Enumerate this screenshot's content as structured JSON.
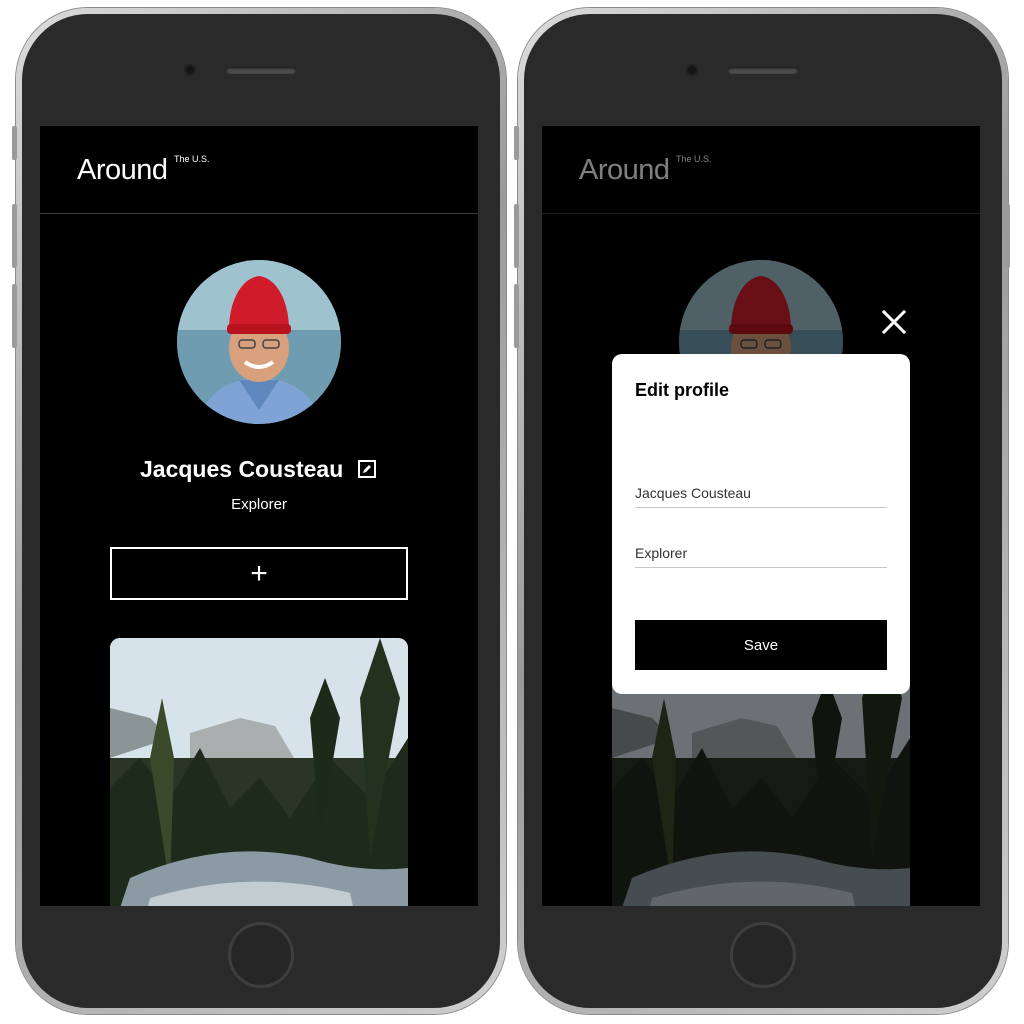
{
  "header": {
    "logo": "Around",
    "logo_superscript": "The U.S."
  },
  "profile": {
    "name": "Jacques Cousteau",
    "about": "Explorer"
  },
  "add_button": {
    "label": "+"
  },
  "edit_modal": {
    "title": "Edit profile",
    "name_value": "Jacques Cousteau",
    "about_value": "Explorer",
    "save_label": "Save"
  },
  "icons": {
    "edit": "pencil-icon",
    "close": "close-icon",
    "add": "plus-icon"
  },
  "colors": {
    "background": "#000000",
    "text": "#ffffff",
    "modal": "#ffffff",
    "save_button": "#000000"
  }
}
